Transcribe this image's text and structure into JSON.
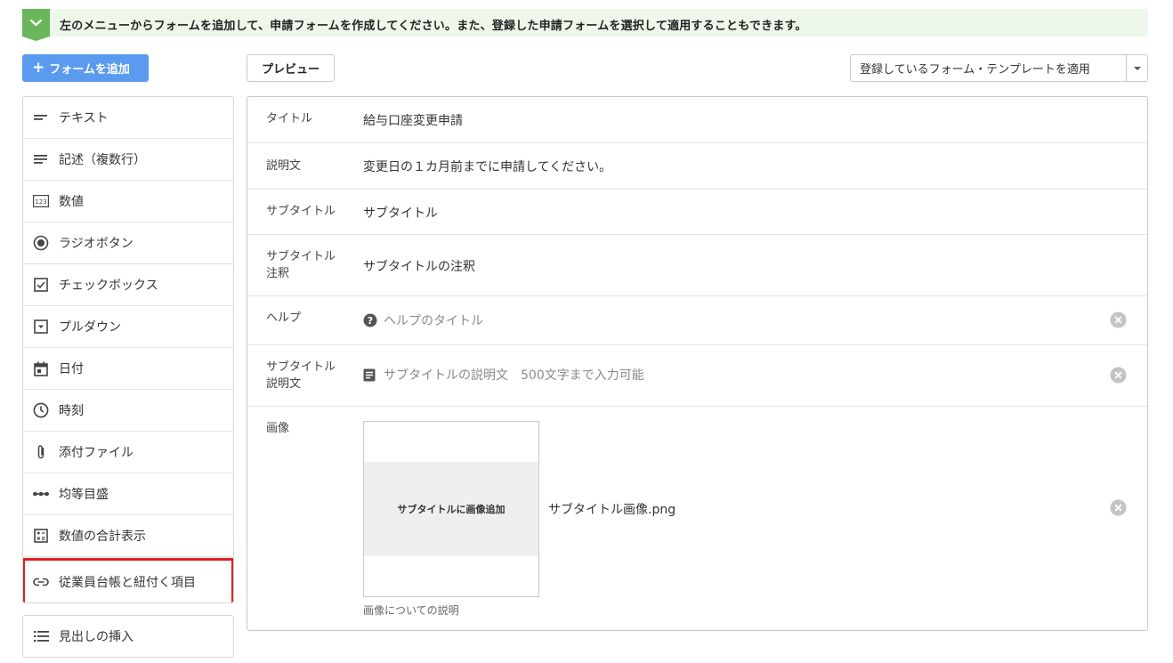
{
  "notice": {
    "text": "左のメニューからフォームを追加して、申請フォームを作成してください。また、登録した申請フォームを選択して適用することもできます。",
    "color": "#6ab65a"
  },
  "toolbar": {
    "add_form": "フォームを追加",
    "add_plus": "+",
    "preview": "プレビュー",
    "apply_template": "登録しているフォーム・テンプレートを適用"
  },
  "sidebar": {
    "items": [
      {
        "label": "テキスト",
        "icon": "short-text-icon"
      },
      {
        "label": "記述（複数行）",
        "icon": "multiline-text-icon"
      },
      {
        "label": "数値",
        "icon": "number-123-icon"
      },
      {
        "label": "ラジオボタン",
        "icon": "radio-button-icon"
      },
      {
        "label": "チェックボックス",
        "icon": "checkbox-icon"
      },
      {
        "label": "プルダウン",
        "icon": "dropdown-icon"
      },
      {
        "label": "日付",
        "icon": "calendar-icon"
      },
      {
        "label": "時刻",
        "icon": "clock-icon"
      },
      {
        "label": "添付ファイル",
        "icon": "paperclip-icon"
      },
      {
        "label": "均等目盛",
        "icon": "scale-dots-icon"
      },
      {
        "label": "数値の合計表示",
        "icon": "calculator-icon"
      },
      {
        "label": "従業員台帳と紐付く項目",
        "icon": "link-icon"
      }
    ],
    "heading_item": {
      "label": "見出しの挿入",
      "icon": "list-icon"
    }
  },
  "form": {
    "rows": [
      {
        "label": "タイトル",
        "value": "給与口座変更申請"
      },
      {
        "label": "説明文",
        "value": "変更日の１カ月前までに申請してください。"
      },
      {
        "label": "サブタイトル",
        "value": "サブタイトル"
      },
      {
        "label_line1": "サブタイトル",
        "label_line2": "注釈",
        "value": "サブタイトルの注釈"
      },
      {
        "label": "ヘルプ",
        "placeholder": "ヘルプのタイトル"
      },
      {
        "label_line1": "サブタイトル",
        "label_line2": "説明文",
        "placeholder": "サブタイトルの説明文　500文字まで入力可能"
      },
      {
        "label": "画像",
        "image_button": "サブタイトルに画像追加",
        "filename": "サブタイトル画像.png",
        "caption": "画像についての説明"
      }
    ]
  },
  "colors": {
    "primary": "#5a9bef",
    "highlight": "#e41e1e",
    "notice_bg": "#edf7ea"
  }
}
